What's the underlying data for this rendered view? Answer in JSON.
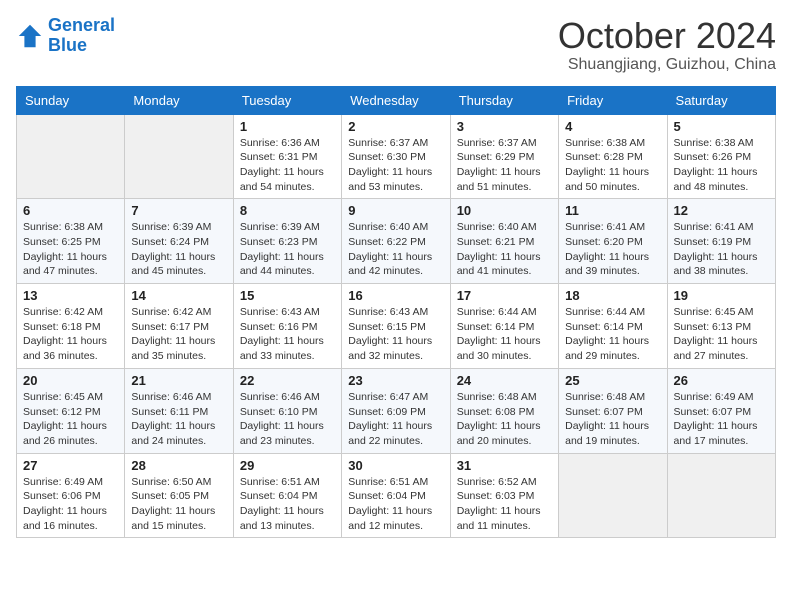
{
  "header": {
    "logo_line1": "General",
    "logo_line2": "Blue",
    "month": "October 2024",
    "location": "Shuangjiang, Guizhou, China"
  },
  "weekdays": [
    "Sunday",
    "Monday",
    "Tuesday",
    "Wednesday",
    "Thursday",
    "Friday",
    "Saturday"
  ],
  "weeks": [
    [
      {
        "day": "",
        "info": ""
      },
      {
        "day": "",
        "info": ""
      },
      {
        "day": "1",
        "info": "Sunrise: 6:36 AM\nSunset: 6:31 PM\nDaylight: 11 hours and 54 minutes."
      },
      {
        "day": "2",
        "info": "Sunrise: 6:37 AM\nSunset: 6:30 PM\nDaylight: 11 hours and 53 minutes."
      },
      {
        "day": "3",
        "info": "Sunrise: 6:37 AM\nSunset: 6:29 PM\nDaylight: 11 hours and 51 minutes."
      },
      {
        "day": "4",
        "info": "Sunrise: 6:38 AM\nSunset: 6:28 PM\nDaylight: 11 hours and 50 minutes."
      },
      {
        "day": "5",
        "info": "Sunrise: 6:38 AM\nSunset: 6:26 PM\nDaylight: 11 hours and 48 minutes."
      }
    ],
    [
      {
        "day": "6",
        "info": "Sunrise: 6:38 AM\nSunset: 6:25 PM\nDaylight: 11 hours and 47 minutes."
      },
      {
        "day": "7",
        "info": "Sunrise: 6:39 AM\nSunset: 6:24 PM\nDaylight: 11 hours and 45 minutes."
      },
      {
        "day": "8",
        "info": "Sunrise: 6:39 AM\nSunset: 6:23 PM\nDaylight: 11 hours and 44 minutes."
      },
      {
        "day": "9",
        "info": "Sunrise: 6:40 AM\nSunset: 6:22 PM\nDaylight: 11 hours and 42 minutes."
      },
      {
        "day": "10",
        "info": "Sunrise: 6:40 AM\nSunset: 6:21 PM\nDaylight: 11 hours and 41 minutes."
      },
      {
        "day": "11",
        "info": "Sunrise: 6:41 AM\nSunset: 6:20 PM\nDaylight: 11 hours and 39 minutes."
      },
      {
        "day": "12",
        "info": "Sunrise: 6:41 AM\nSunset: 6:19 PM\nDaylight: 11 hours and 38 minutes."
      }
    ],
    [
      {
        "day": "13",
        "info": "Sunrise: 6:42 AM\nSunset: 6:18 PM\nDaylight: 11 hours and 36 minutes."
      },
      {
        "day": "14",
        "info": "Sunrise: 6:42 AM\nSunset: 6:17 PM\nDaylight: 11 hours and 35 minutes."
      },
      {
        "day": "15",
        "info": "Sunrise: 6:43 AM\nSunset: 6:16 PM\nDaylight: 11 hours and 33 minutes."
      },
      {
        "day": "16",
        "info": "Sunrise: 6:43 AM\nSunset: 6:15 PM\nDaylight: 11 hours and 32 minutes."
      },
      {
        "day": "17",
        "info": "Sunrise: 6:44 AM\nSunset: 6:14 PM\nDaylight: 11 hours and 30 minutes."
      },
      {
        "day": "18",
        "info": "Sunrise: 6:44 AM\nSunset: 6:14 PM\nDaylight: 11 hours and 29 minutes."
      },
      {
        "day": "19",
        "info": "Sunrise: 6:45 AM\nSunset: 6:13 PM\nDaylight: 11 hours and 27 minutes."
      }
    ],
    [
      {
        "day": "20",
        "info": "Sunrise: 6:45 AM\nSunset: 6:12 PM\nDaylight: 11 hours and 26 minutes."
      },
      {
        "day": "21",
        "info": "Sunrise: 6:46 AM\nSunset: 6:11 PM\nDaylight: 11 hours and 24 minutes."
      },
      {
        "day": "22",
        "info": "Sunrise: 6:46 AM\nSunset: 6:10 PM\nDaylight: 11 hours and 23 minutes."
      },
      {
        "day": "23",
        "info": "Sunrise: 6:47 AM\nSunset: 6:09 PM\nDaylight: 11 hours and 22 minutes."
      },
      {
        "day": "24",
        "info": "Sunrise: 6:48 AM\nSunset: 6:08 PM\nDaylight: 11 hours and 20 minutes."
      },
      {
        "day": "25",
        "info": "Sunrise: 6:48 AM\nSunset: 6:07 PM\nDaylight: 11 hours and 19 minutes."
      },
      {
        "day": "26",
        "info": "Sunrise: 6:49 AM\nSunset: 6:07 PM\nDaylight: 11 hours and 17 minutes."
      }
    ],
    [
      {
        "day": "27",
        "info": "Sunrise: 6:49 AM\nSunset: 6:06 PM\nDaylight: 11 hours and 16 minutes."
      },
      {
        "day": "28",
        "info": "Sunrise: 6:50 AM\nSunset: 6:05 PM\nDaylight: 11 hours and 15 minutes."
      },
      {
        "day": "29",
        "info": "Sunrise: 6:51 AM\nSunset: 6:04 PM\nDaylight: 11 hours and 13 minutes."
      },
      {
        "day": "30",
        "info": "Sunrise: 6:51 AM\nSunset: 6:04 PM\nDaylight: 11 hours and 12 minutes."
      },
      {
        "day": "31",
        "info": "Sunrise: 6:52 AM\nSunset: 6:03 PM\nDaylight: 11 hours and 11 minutes."
      },
      {
        "day": "",
        "info": ""
      },
      {
        "day": "",
        "info": ""
      }
    ]
  ]
}
